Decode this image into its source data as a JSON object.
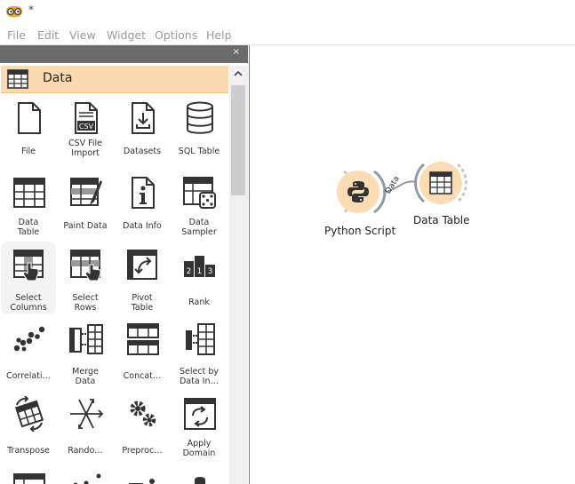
{
  "title_bar": {
    "title": "*",
    "app_icon": "orange-glasses-logo"
  },
  "menu": [
    "File",
    "Edit",
    "View",
    "Widget",
    "Options",
    "Help"
  ],
  "dock": {
    "close_label": "×",
    "category": {
      "label": "Data",
      "icon": "table-icon"
    },
    "widgets": [
      {
        "label": "File",
        "icon": "file-icon"
      },
      {
        "label": "CSV File\nImport",
        "icon": "csv-file-icon"
      },
      {
        "label": "Datasets",
        "icon": "datasets-icon"
      },
      {
        "label": "SQL Table",
        "icon": "database-icon"
      },
      {
        "label": "Data\nTable",
        "icon": "data-table-icon"
      },
      {
        "label": "Paint Data",
        "icon": "paint-data-icon"
      },
      {
        "label": "Data Info",
        "icon": "info-icon"
      },
      {
        "label": "Data\nSampler",
        "icon": "sampler-icon"
      },
      {
        "label": "Select\nColumns",
        "icon": "select-columns-icon",
        "selected": true
      },
      {
        "label": "Select\nRows",
        "icon": "select-rows-icon"
      },
      {
        "label": "Pivot\nTable",
        "icon": "pivot-table-icon"
      },
      {
        "label": "Rank",
        "icon": "rank-icon"
      },
      {
        "label": "Correlati…",
        "icon": "correlations-icon"
      },
      {
        "label": "Merge\nData",
        "icon": "merge-data-icon"
      },
      {
        "label": "Concat…",
        "icon": "concatenate-icon"
      },
      {
        "label": "Select by\nData In…",
        "icon": "select-by-index-icon"
      },
      {
        "label": "Transpose",
        "icon": "transpose-icon"
      },
      {
        "label": "Rando…",
        "icon": "randomize-icon"
      },
      {
        "label": "Preproc…",
        "icon": "preprocess-icon"
      },
      {
        "label": "Apply\nDomain",
        "icon": "apply-domain-icon"
      }
    ]
  },
  "canvas": {
    "nodes": [
      {
        "label": "Python Script",
        "icon": "python-icon"
      },
      {
        "label": "Data Table",
        "icon": "data-table-icon"
      }
    ],
    "link_label": "Data"
  }
}
